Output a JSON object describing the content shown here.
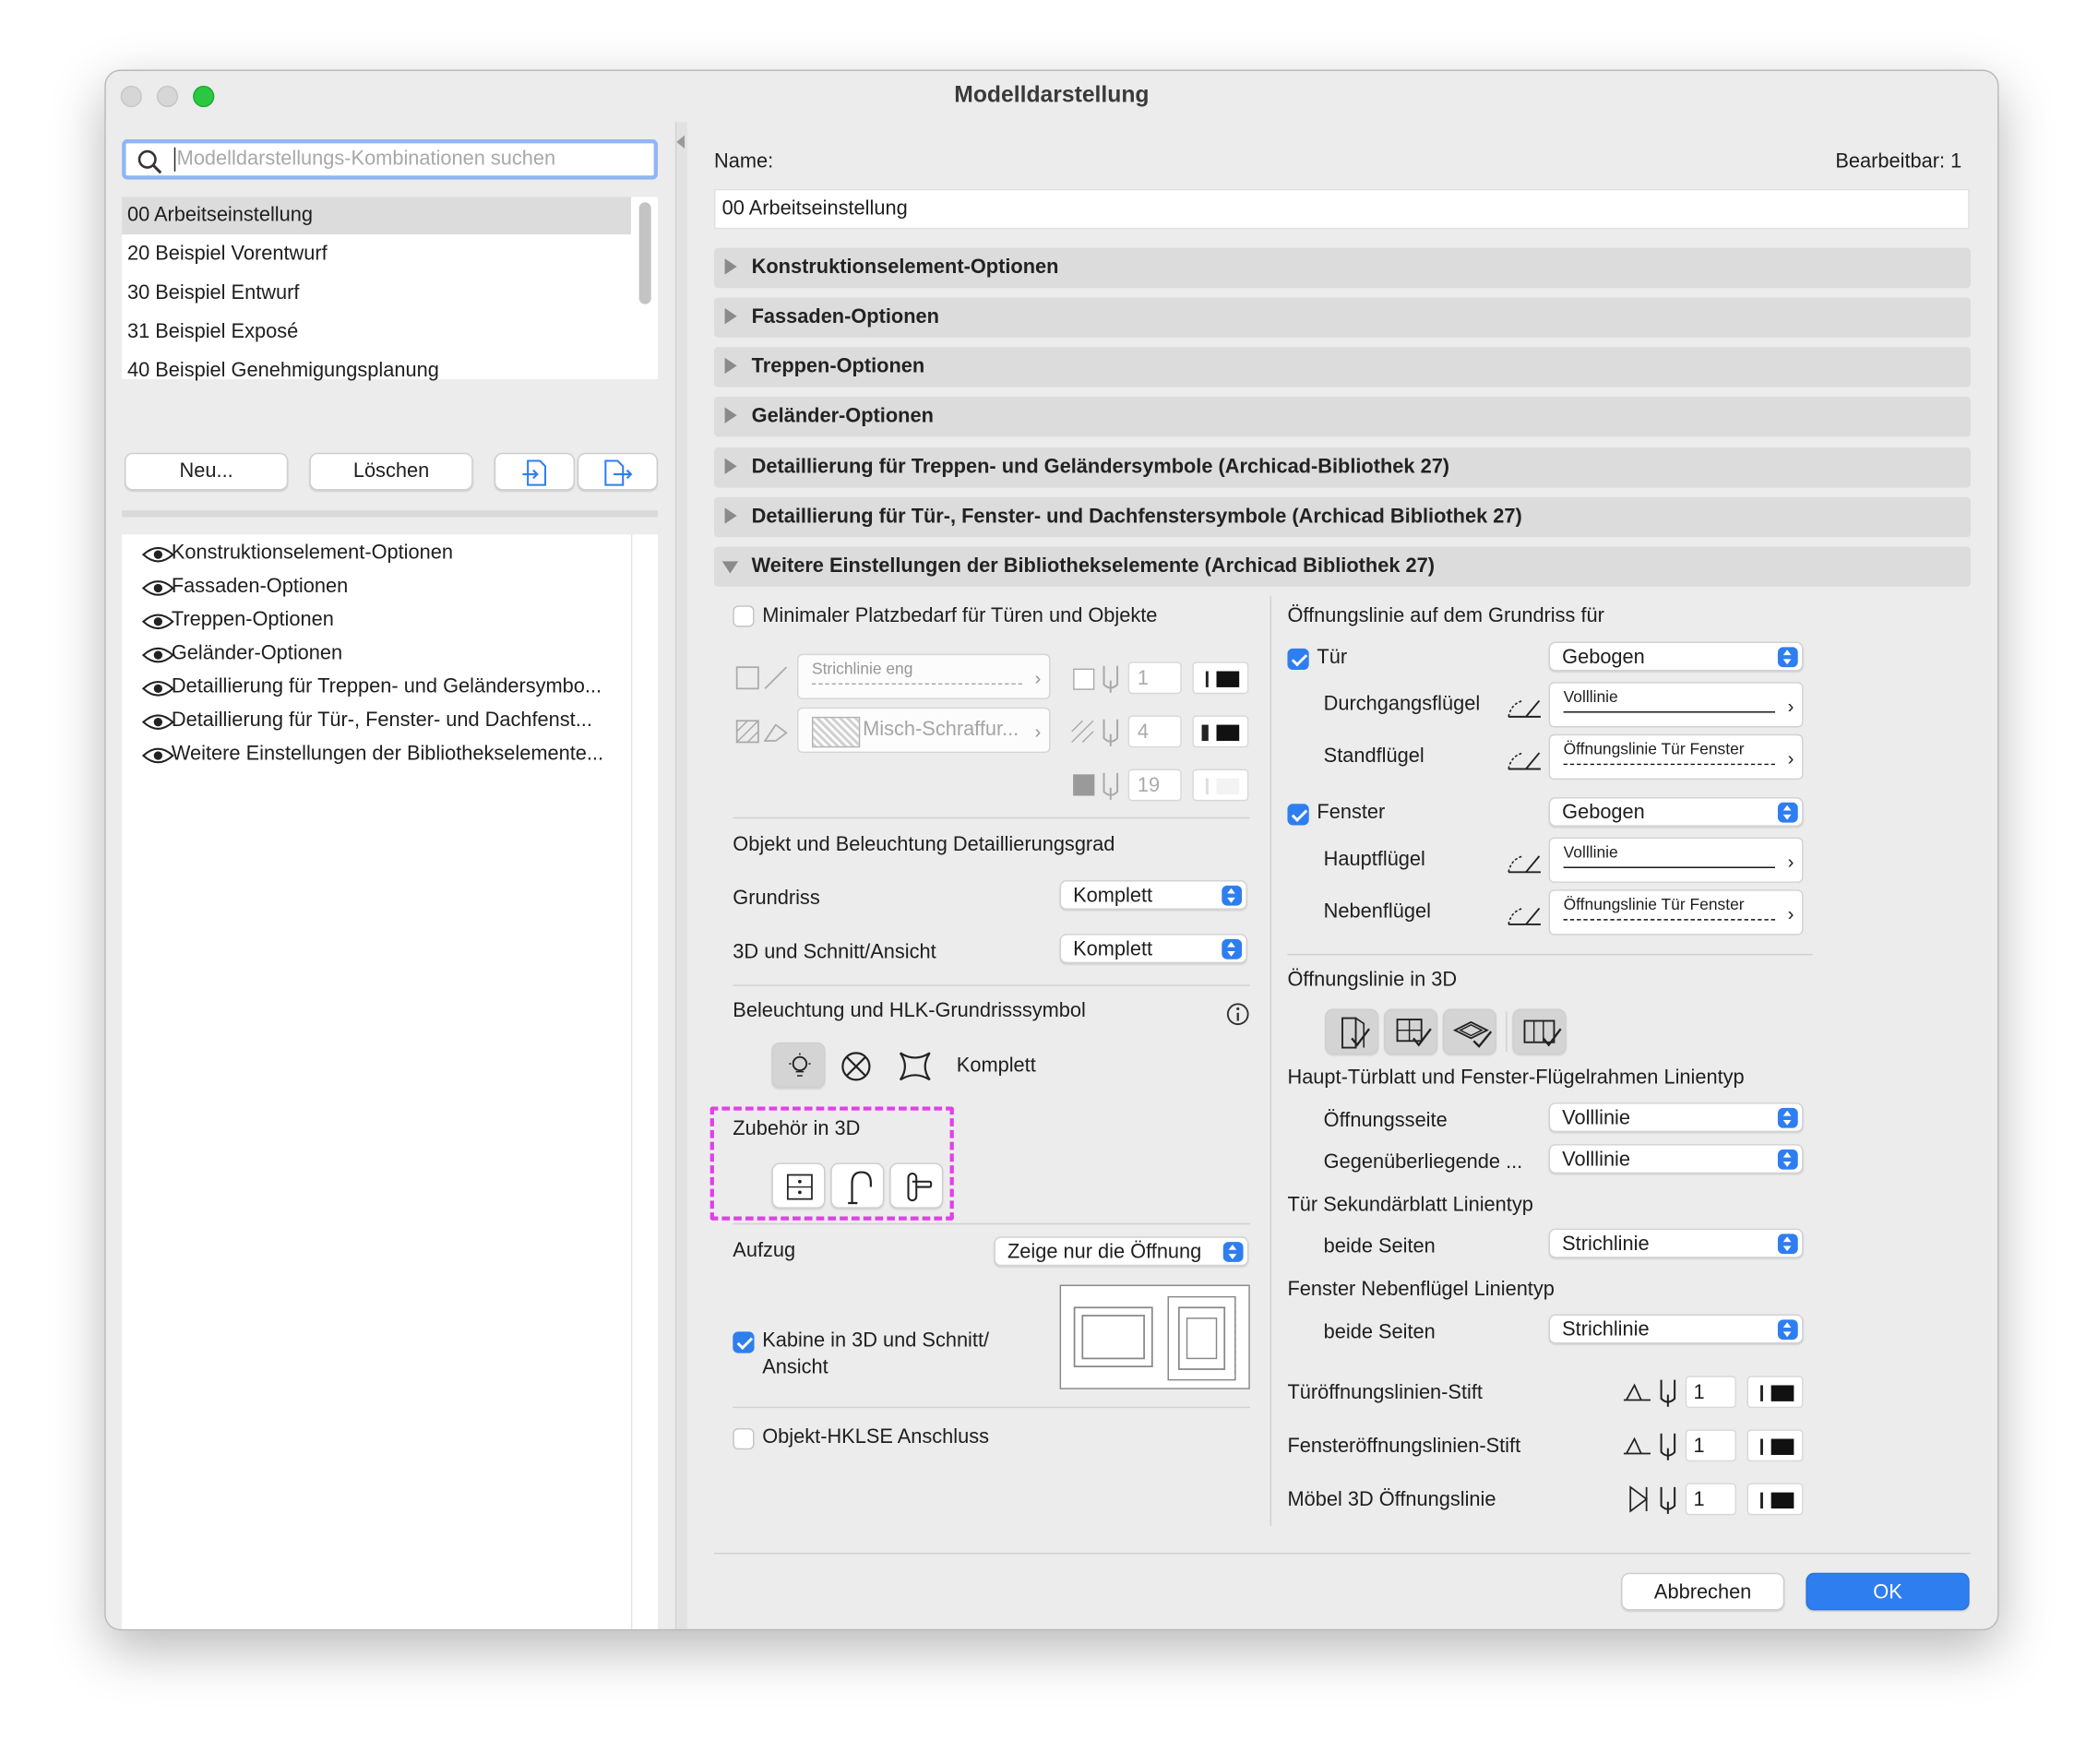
{
  "window": {
    "title": "Modelldarstellung"
  },
  "left": {
    "search_placeholder": "Modelldarstellungs-Kombinationen suchen",
    "combinations": [
      "00 Arbeitseinstellung",
      "20 Beispiel Vorentwurf",
      "30 Beispiel Entwurf",
      "31 Beispiel Exposé",
      "40 Beispiel Genehmigungsplanung"
    ],
    "buttons": {
      "new": "Neu...",
      "delete": "Löschen"
    },
    "visible_sections": [
      "Konstruktionselement-Optionen",
      "Fassaden-Optionen",
      "Treppen-Optionen",
      "Geländer-Optionen",
      "Detaillierung für Treppen- und Geländersymbo...",
      "Detaillierung für Tür-, Fenster- und Dachfenst...",
      "Weitere Einstellungen der Bibliothekselemente..."
    ]
  },
  "header": {
    "name_label": "Name:",
    "editable": "Bearbeitbar: 1",
    "name_value": "00 Arbeitseinstellung"
  },
  "sections": [
    "Konstruktionselement-Optionen",
    "Fassaden-Optionen",
    "Treppen-Optionen",
    "Geländer-Optionen",
    "Detaillierung für Treppen- und Geländersymbole (Archicad-Bibliothek 27)",
    "Detaillierung für Tür-, Fenster- und Dachfenstersymbole (Archicad Bibliothek 27)",
    "Weitere Einstellungen der Bibliothekselemente (Archicad Bibliothek 27)"
  ],
  "lib": {
    "min_space": "Minimaler Platzbedarf für Türen und Objekte",
    "line_type": "Strichlinie eng",
    "fill_type": "Misch-Schraffur...",
    "pen1": "1",
    "pen2": "4",
    "pen3": "19",
    "detail_title": "Objekt und Beleuchtung Detaillierungsgrad",
    "grundriss_label": "Grundriss",
    "grundriss_value": "Komplett",
    "schnitt_label": "3D und Schnitt/Ansicht",
    "schnitt_value": "Komplett",
    "light_title": "Beleuchtung und HLK-Grundrisssymbol",
    "light_value": "Komplett",
    "accessory_title": "Zubehör in 3D",
    "lift_label": "Aufzug",
    "lift_value": "Zeige nur die Öffnung",
    "cabin_label_1": "Kabine in 3D und Schnitt/",
    "cabin_label_2": "Ansicht",
    "hklse_label": "Objekt-HKLSE Anschluss",
    "opening_title": "Öffnungslinie auf dem Grundriss für",
    "door_label": "Tür",
    "door_value": "Gebogen",
    "door_pass_label": "Durchgangsflügel",
    "door_pass_line": "Volllinie",
    "door_fixed_label": "Standflügel",
    "door_fixed_line": "Öffnungslinie Tür Fenster",
    "window_label": "Fenster",
    "window_value": "Gebogen",
    "win_main_label": "Hauptflügel",
    "win_main_line": "Volllinie",
    "win_side_label": "Nebenflügel",
    "win_side_line": "Öffnungslinie Tür Fenster",
    "opening3d_title": "Öffnungslinie in 3D",
    "main_leaf_title": "Haupt-Türblatt und Fenster-Flügelrahmen Linientyp",
    "open_side_label": "Öffnungsseite",
    "open_side_value": "Volllinie",
    "opposite_label": "Gegenüberliegende ...",
    "opposite_value": "Volllinie",
    "secondary_title": "Tür Sekundärblatt Linientyp",
    "sec_both_label": "beide Seiten",
    "sec_both_value": "Strichlinie",
    "win_side_title": "Fenster Nebenflügel Linientyp",
    "ws_both_label": "beide Seiten",
    "ws_both_value": "Strichlinie",
    "door_pen_label": "Türöffnungslinien-Stift",
    "door_pen": "1",
    "win_pen_label": "Fensteröffnungslinien-Stift",
    "win_pen": "1",
    "furn_label": "Möbel 3D Öffnungslinie",
    "furn_pen": "1"
  },
  "footer": {
    "cancel": "Abbrechen",
    "ok": "OK"
  },
  "colors": {
    "accent": "#2f7ef0",
    "highlight": "#e040e8"
  }
}
